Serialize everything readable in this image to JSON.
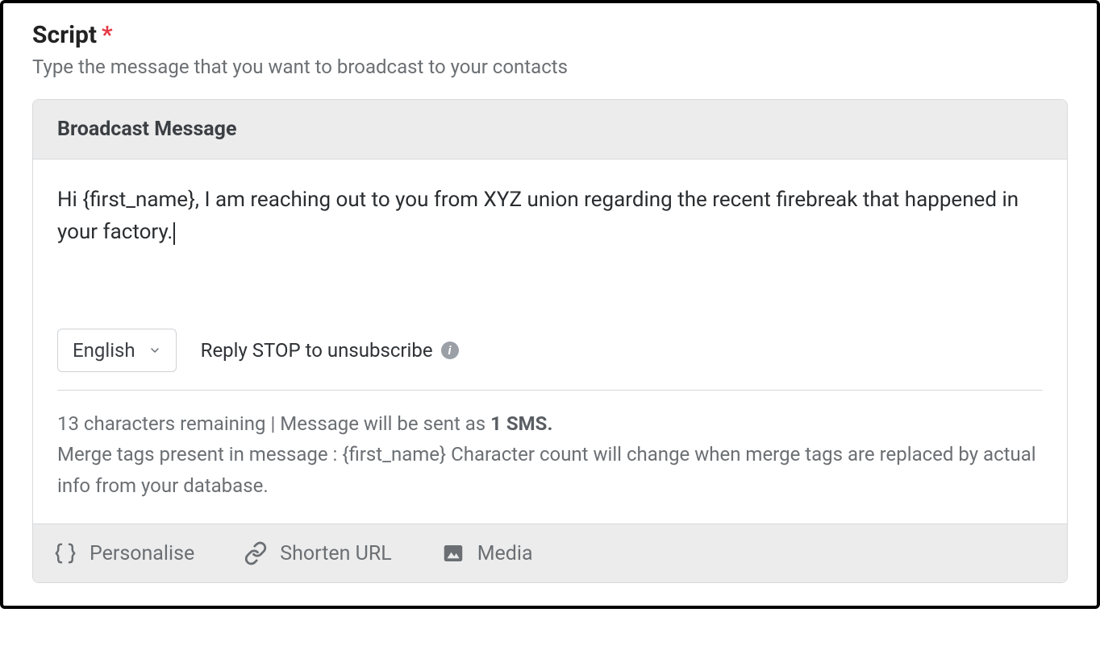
{
  "header": {
    "title": "Script",
    "required_mark": "*",
    "subtitle": "Type the message that you want to broadcast to your contacts"
  },
  "card": {
    "title": "Broadcast Message"
  },
  "message": {
    "text": "Hi {first_name}, I am reaching out to you from XYZ union regarding the recent firebreak that happened in your factory."
  },
  "language": {
    "selected": "English"
  },
  "unsubscribe": {
    "text": "Reply STOP to unsubscribe"
  },
  "status": {
    "chars_remaining_prefix": "13 characters remaining | Message will be sent as ",
    "sms_count": "1 SMS.",
    "merge_tags_line": "Merge tags present in message : {first_name} Character count will change when merge tags are replaced by actual info from your database."
  },
  "footer": {
    "personalise": "Personalise",
    "shorten_url": "Shorten URL",
    "media": "Media"
  }
}
